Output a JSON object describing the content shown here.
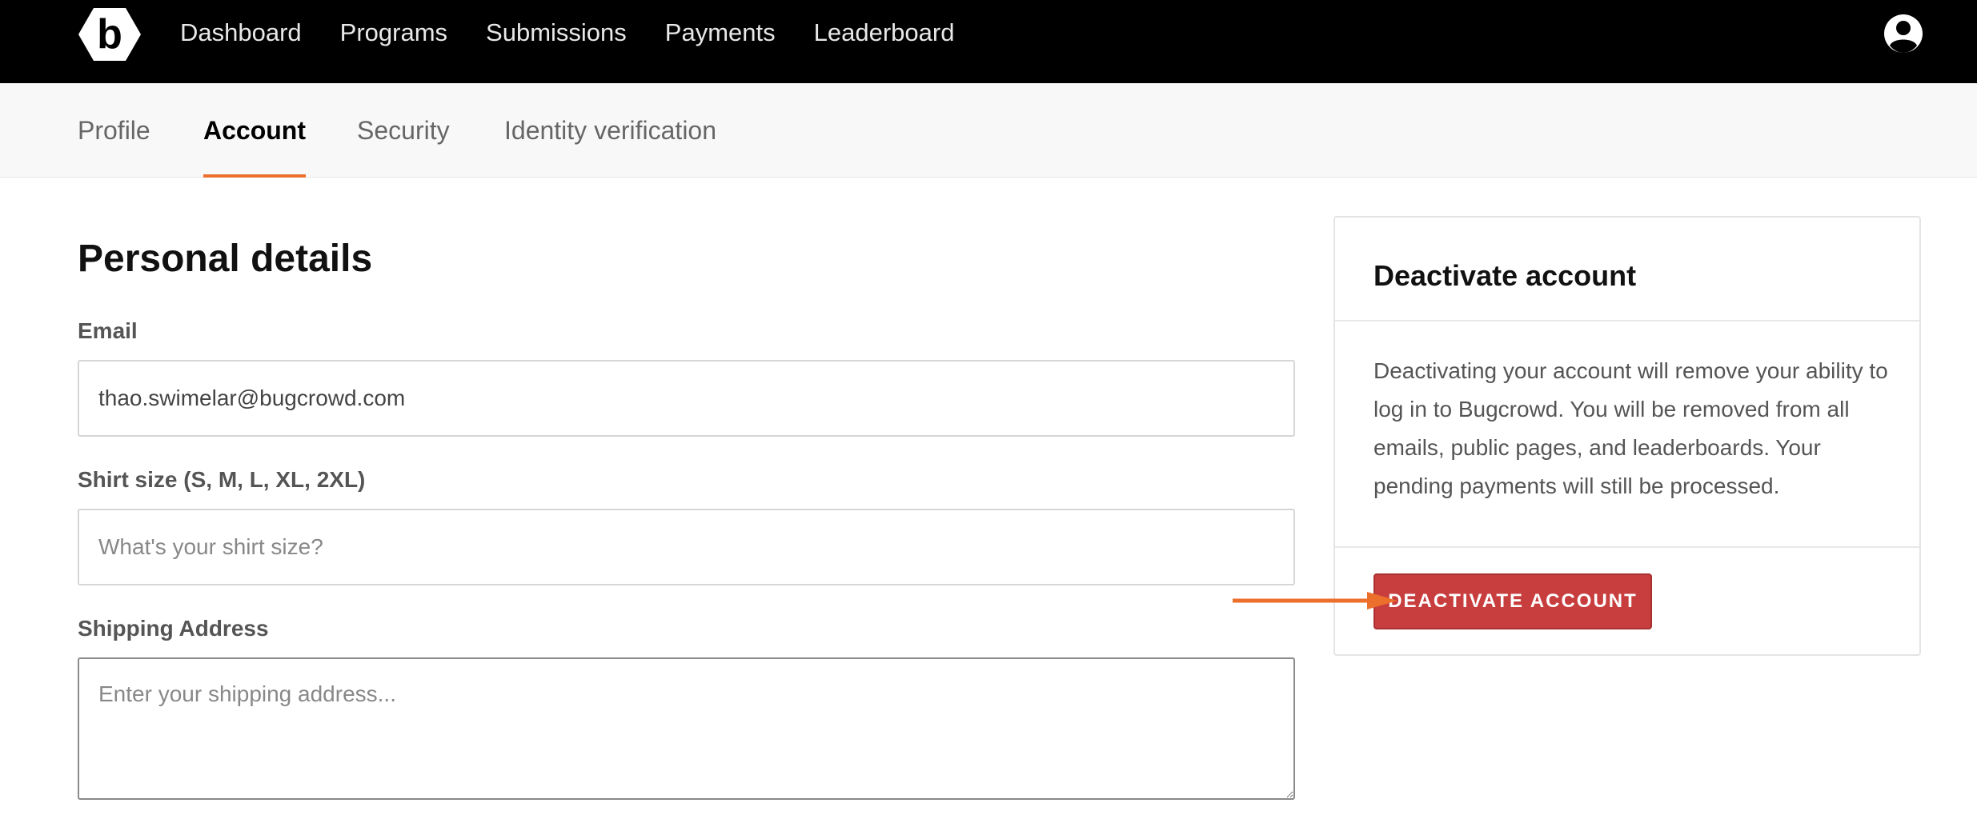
{
  "topnav": {
    "logo_letter": "b",
    "links": [
      "Dashboard",
      "Programs",
      "Submissions",
      "Payments",
      "Leaderboard"
    ],
    "user_icon": "user-circle-icon"
  },
  "subnav": {
    "tabs": [
      "Profile",
      "Account",
      "Security",
      "Identity verification"
    ],
    "active": "Account"
  },
  "main": {
    "title": "Personal details",
    "email": {
      "label": "Email",
      "value": "thao.swimelar@bugcrowd.com"
    },
    "shirt": {
      "label": "Shirt size (S, M, L, XL, 2XL)",
      "placeholder": "What's your shirt size?"
    },
    "shipping": {
      "label": "Shipping Address",
      "placeholder": "Enter your shipping address..."
    }
  },
  "deactivate": {
    "title": "Deactivate account",
    "description": "Deactivating your account will remove your ability to log in to Bugcrowd. You will be removed from all emails, public pages, and leaderboards. Your pending payments will still be processed.",
    "button_label": "DEACTIVATE ACCOUNT"
  },
  "colors": {
    "nav_bg": "#000000",
    "accent": "#ec6f2b",
    "danger": "#c83d3d"
  }
}
